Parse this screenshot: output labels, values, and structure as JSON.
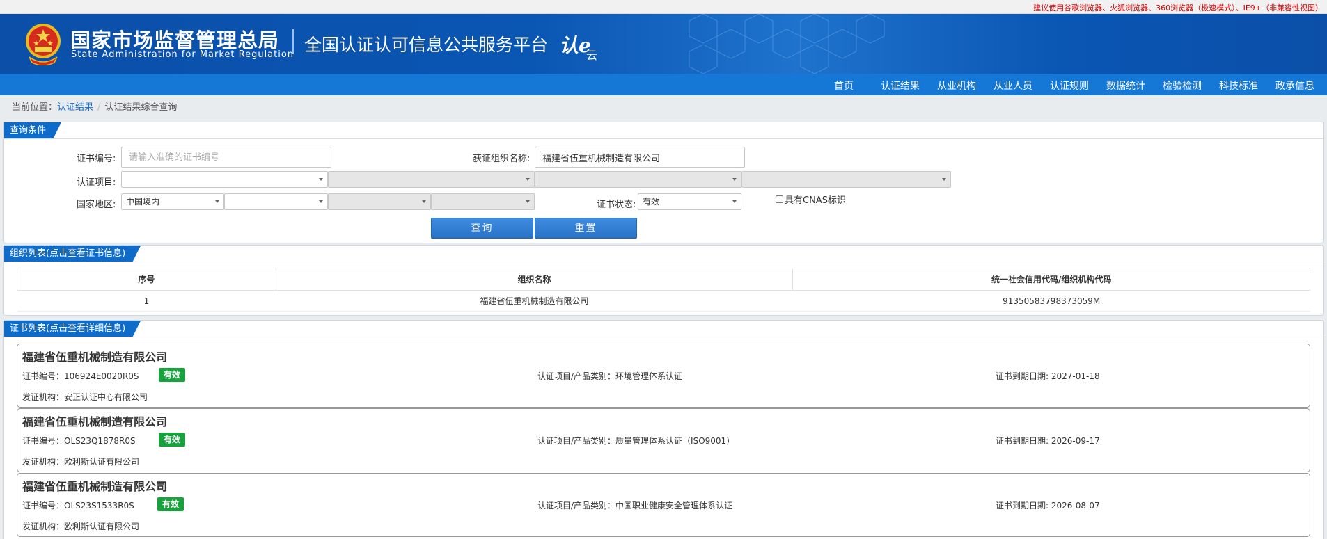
{
  "top_notice": "建议使用谷歌浏览器、火狐浏览器、360浏览器（极速模式）、IE9+（非兼容性视图）",
  "header": {
    "bureau_cn": "国家市场监督管理总局",
    "bureau_en": "State Administration  for  Market Regulation",
    "platform": "全国认证认可信息公共服务平台",
    "logo_text": "认e",
    "logo_sub": "云"
  },
  "nav": {
    "items": [
      "首页",
      "认证结果",
      "从业机构",
      "从业人员",
      "认证规则",
      "数据统计",
      "检验检测",
      "科技标准",
      "政承信息"
    ]
  },
  "breadcrumb": {
    "prefix": "当前位置：",
    "link": "认证结果",
    "sep": "/",
    "current": "认证结果综合查询"
  },
  "query": {
    "title": "查询条件",
    "cert_no_label": "证书编号:",
    "cert_no_placeholder": "请输入准确的证书编号",
    "org_name_label": "获证组织名称:",
    "org_name_value": "福建省伍重机械制造有限公司",
    "project_label": "认证项目:",
    "region_label": "国家地区:",
    "region_value": "中国境内",
    "status_label": "证书状态:",
    "status_value": "有效",
    "cnas_label": "具有CNAS标识",
    "search_button": "查询",
    "reset_button": "重置"
  },
  "org_list": {
    "title": "组织列表(点击查看证书信息)",
    "columns": [
      "序号",
      "组织名称",
      "统一社会信用代码/组织机构代码"
    ],
    "rows": [
      [
        "1",
        "福建省伍重机械制造有限公司",
        "91350583798373059M"
      ]
    ]
  },
  "cert_list": {
    "title": "证书列表(点击查看详细信息)",
    "cert_no_prefix": "证书编号：",
    "project_prefix": "认证项目/产品类别：",
    "expiry_prefix": "证书到期日期: ",
    "issuer_prefix": "发证机构：",
    "items": [
      {
        "org": "福建省伍重机械制造有限公司",
        "cert_no": "106924E0020R0S",
        "status": "有效",
        "project": "环境管理体系认证",
        "expiry": "2027-01-18",
        "issuer": "安正认证中心有限公司"
      },
      {
        "org": "福建省伍重机械制造有限公司",
        "cert_no": "OLS23Q1878R0S",
        "status": "有效",
        "project": "质量管理体系认证（ISO9001）",
        "expiry": "2026-09-17",
        "issuer": "欧利斯认证有限公司"
      },
      {
        "org": "福建省伍重机械制造有限公司",
        "cert_no": "OLS23S1533R0S",
        "status": "有效",
        "project": "中国职业健康安全管理体系认证",
        "expiry": "2026-08-07",
        "issuer": "欧利斯认证有限公司"
      }
    ]
  },
  "colors": {
    "banner": "#0b4fa8",
    "nav": "#1678d6",
    "tab": "#0f6bc9",
    "badge": "#18a23e",
    "notice": "#d40000"
  }
}
